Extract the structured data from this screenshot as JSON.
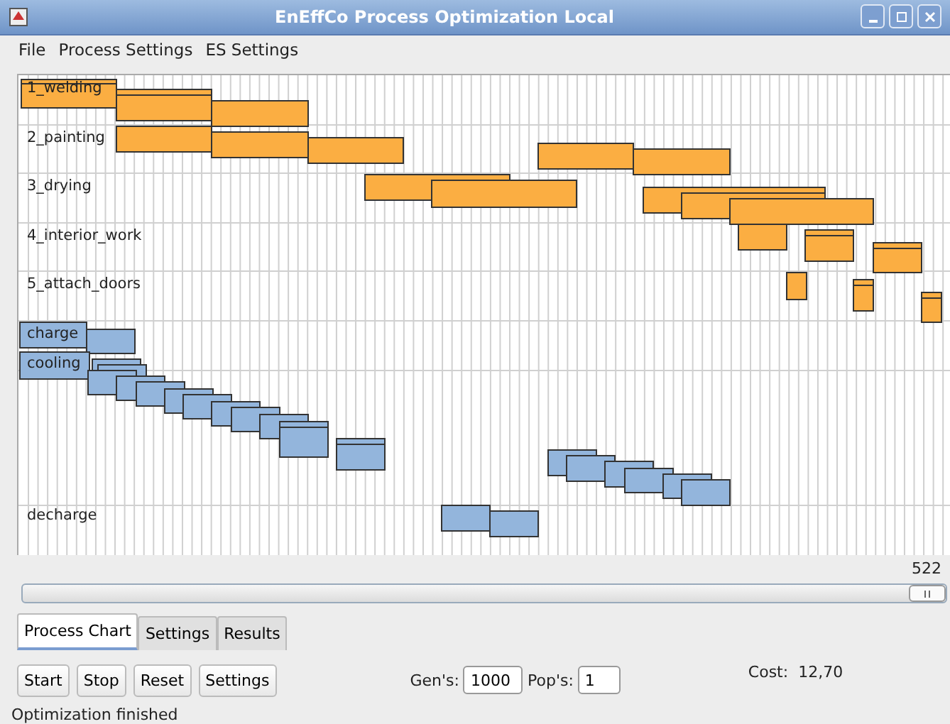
{
  "window": {
    "title": "EnEffCo Process Optimization Local"
  },
  "menu": [
    "File",
    "Process Settings",
    "ES Settings"
  ],
  "chart": {
    "lanes": [
      {
        "label": "1_welding"
      },
      {
        "label": "2_painting"
      },
      {
        "label": "3_drying"
      },
      {
        "label": "4_interior_work"
      },
      {
        "label": "5_attach_doors"
      },
      {
        "label": "charge"
      },
      {
        "label": "cooling"
      },
      {
        "label": "decharge"
      }
    ]
  },
  "slider": {
    "reading": "522",
    "level": 1
  },
  "tabs": [
    {
      "label": "Process Chart",
      "selected": true
    },
    {
      "label": "Settings",
      "selected": false
    },
    {
      "label": "Results",
      "selected": false
    }
  ],
  "buttons": [
    "Start",
    "Stop",
    "Reset",
    "Settings"
  ],
  "fields": [
    {
      "label": "Gen's:",
      "value": "1000"
    },
    {
      "label": "Pop's:",
      "value": "1"
    }
  ],
  "cost": {
    "label": "Cost:",
    "value": "12,70"
  },
  "status_bar": "Optimization finished"
}
